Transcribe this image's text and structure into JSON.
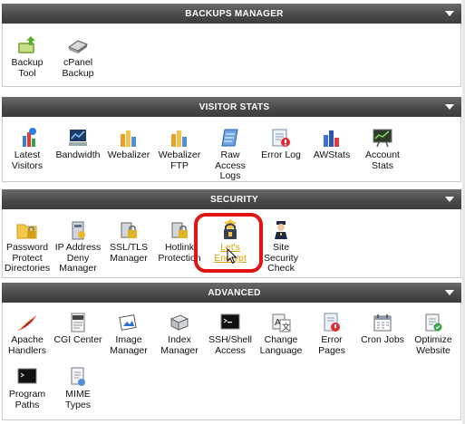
{
  "sections": [
    {
      "title": "BACKUPS MANAGER",
      "items": [
        {
          "label": "Backup Tool",
          "icon": "backup-tool-icon"
        },
        {
          "label": "cPanel Backup",
          "icon": "cpanel-backup-icon"
        }
      ]
    },
    {
      "title": "VISITOR STATS",
      "items": [
        {
          "label": "Latest Visitors",
          "icon": "latest-visitors-icon"
        },
        {
          "label": "Bandwidth",
          "icon": "bandwidth-icon"
        },
        {
          "label": "Webalizer",
          "icon": "webalizer-icon"
        },
        {
          "label": "Webalizer FTP",
          "icon": "webalizer-ftp-icon"
        },
        {
          "label": "Raw Access Logs",
          "icon": "raw-access-logs-icon"
        },
        {
          "label": "Error Log",
          "icon": "error-log-icon"
        },
        {
          "label": "AWStats",
          "icon": "awstats-icon"
        },
        {
          "label": "Account Stats",
          "icon": "account-stats-icon"
        }
      ]
    },
    {
      "title": "SECURITY",
      "items": [
        {
          "label": "Password Protect Directories",
          "icon": "folder-lock-icon"
        },
        {
          "label": "IP Address Deny Manager",
          "icon": "ip-deny-icon"
        },
        {
          "label": "SSL/TLS Manager",
          "icon": "ssl-tls-icon"
        },
        {
          "label": "Hotlink Protection",
          "icon": "hotlink-icon"
        },
        {
          "label": "Let's Encrypt",
          "icon": "lets-encrypt-icon",
          "highlighted": true
        },
        {
          "label": "Site Security Check",
          "icon": "site-security-icon"
        }
      ]
    },
    {
      "title": "ADVANCED",
      "items": [
        {
          "label": "Apache Handlers",
          "icon": "apache-feather-icon"
        },
        {
          "label": "CGI Center",
          "icon": "cgi-icon"
        },
        {
          "label": "Image Manager",
          "icon": "image-manager-icon"
        },
        {
          "label": "Index Manager",
          "icon": "index-manager-icon"
        },
        {
          "label": "SSH/Shell Access",
          "icon": "terminal-icon"
        },
        {
          "label": "Change Language",
          "icon": "language-icon"
        },
        {
          "label": "Error Pages",
          "icon": "error-pages-icon"
        },
        {
          "label": "Cron Jobs",
          "icon": "cron-calendar-icon"
        },
        {
          "label": "Optimize Website",
          "icon": "optimize-icon"
        },
        {
          "label": "Program Paths",
          "icon": "program-paths-icon"
        },
        {
          "label": "MIME Types",
          "icon": "mime-types-icon"
        }
      ]
    }
  ],
  "colors": {
    "header": "#4a4a4a",
    "highlight_ring": "#e11414",
    "hover_text": "#d9a000"
  }
}
